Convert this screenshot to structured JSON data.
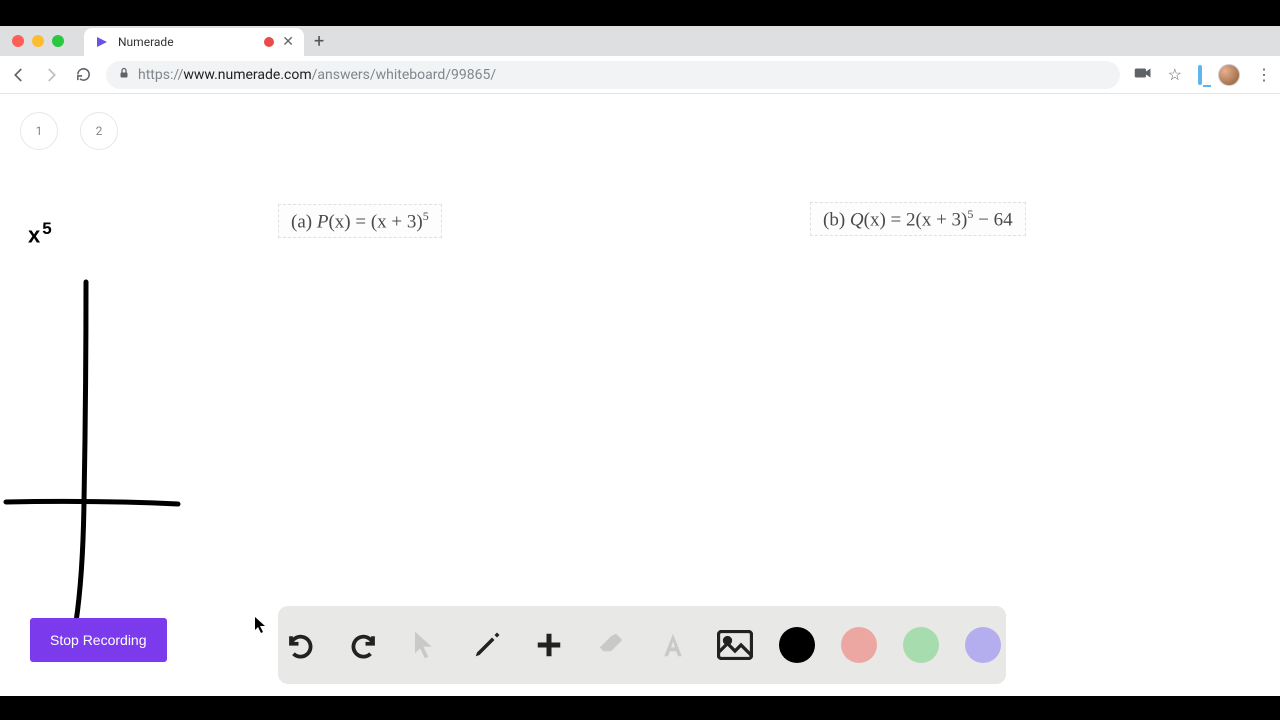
{
  "browser": {
    "tab_title": "Numerade",
    "url_scheme": "https://",
    "url_host": "www.numerade.com",
    "url_path": "/answers/whiteboard/99865/"
  },
  "page_tabs": {
    "tab1": "1",
    "tab2": "2"
  },
  "equations": {
    "a_label": "(a) ",
    "a_func": "P",
    "a_of": "(x) = (x + 3)",
    "a_pow": "5",
    "b_label": "(b) ",
    "b_func": "Q",
    "b_of": "(x) = 2(x + 3)",
    "b_pow": "5",
    "b_tail": " − 64"
  },
  "drawing": {
    "x_label": "x",
    "x_power": "5"
  },
  "buttons": {
    "stop_recording": "Stop Recording"
  },
  "toolbar": {
    "undo": "undo",
    "redo": "redo",
    "pointer": "pointer",
    "pen": "pen",
    "plus": "plus",
    "eraser": "eraser",
    "text": "text",
    "image": "image"
  },
  "colors": {
    "accent": "#7c3aed",
    "swatches": {
      "black": "#000000",
      "red": "#eda7a2",
      "green": "#a7dcae",
      "purple": "#b5aeee"
    }
  }
}
